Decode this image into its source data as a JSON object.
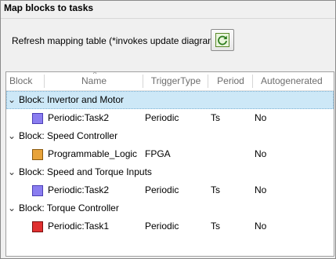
{
  "panel": {
    "title": "Map blocks to tasks",
    "refresh_label": "Refresh mapping table (*invokes update diagram)"
  },
  "table": {
    "columns": [
      "Block",
      "Name",
      "TriggerType",
      "Period",
      "Autogenerated"
    ],
    "groups": [
      {
        "label": "Block: Invertor and Motor",
        "selected": true,
        "row": {
          "icon": "periodic-task-icon",
          "name": "Periodic:Task2",
          "trigger": "Periodic",
          "period": "Ts",
          "auto": "No"
        }
      },
      {
        "label": "Block: Speed Controller",
        "selected": false,
        "row": {
          "icon": "fpga-block-icon",
          "name": "Programmable_Logic",
          "trigger": "FPGA",
          "period": "",
          "auto": "No"
        }
      },
      {
        "label": "Block: Speed and Torque Inputs",
        "selected": false,
        "row": {
          "icon": "periodic-task-icon",
          "name": "Periodic:Task2",
          "trigger": "Periodic",
          "period": "Ts",
          "auto": "No"
        }
      },
      {
        "label": "Block: Torque Controller",
        "selected": false,
        "row": {
          "icon": "torque-task-icon",
          "name": "Periodic:Task1",
          "trigger": "Periodic",
          "period": "Ts",
          "auto": "No"
        }
      }
    ]
  },
  "colors": {
    "selection": "#cde8f7",
    "periodic_icon": "#8a7df0",
    "fpga_icon": "#e8a33a",
    "task1_icon": "#e03030"
  }
}
